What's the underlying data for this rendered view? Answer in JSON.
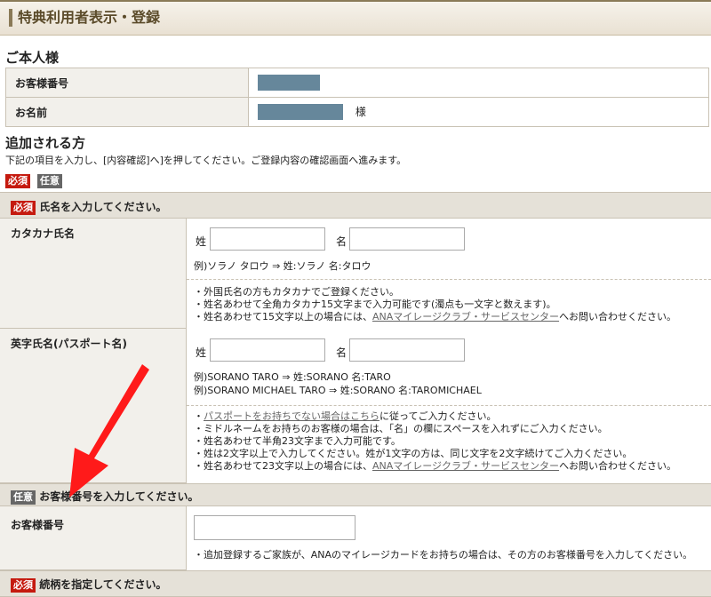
{
  "page_title": "特典利用者表示・登録",
  "self_section": {
    "heading": "ご本人様",
    "rows": [
      {
        "label": "お客様番号",
        "suffix": ""
      },
      {
        "label": "お名前",
        "suffix": "様"
      }
    ]
  },
  "add_section": {
    "heading": "追加される方",
    "instruction": "下記の項目を入力し、[内容確認]へ]を押してください。ご登録内容の確認画面へ進みます。",
    "legend_required": "必須",
    "legend_optional": "任意"
  },
  "name_block": {
    "badge": "必須",
    "title": "氏名を入力してください。",
    "katakana": {
      "label": "カタカナ氏名",
      "last_label": "姓",
      "first_label": "名",
      "example": "例)ソラノ タロウ ⇒ 姓:ソラノ 名:タロウ",
      "notes": [
        "・外国氏名の方もカタカナでご登録ください。",
        "・姓名あわせて全角カタカナ15文字まで入力可能です(濁点も一文字と数えます)。",
        "・姓名あわせて15文字以上の場合には、"
      ],
      "note_link": "ANAマイレージクラブ・サービスセンター",
      "note_tail": "へお問い合わせください。"
    },
    "romaji": {
      "label": "英字氏名(パスポート名)",
      "last_label": "姓",
      "first_label": "名",
      "example1": "例)SORANO TARO ⇒ 姓:SORANO 名:TARO",
      "example2": "例)SORANO MICHAEL TARO ⇒ 姓:SORANO 名:TAROMICHAEL",
      "note1_link": "パスポートをお持ちでない場合はこちら",
      "note1_tail": "に従ってご入力ください。",
      "notes": [
        "・ミドルネームをお持ちのお客様の場合は、「名」の欄にスペースを入れずにご入力ください。",
        "・姓名あわせて半角23文字まで入力可能です。",
        "・姓は2文字以上で入力してください。姓が1文字の方は、同じ文字を2文字続けてご入力ください。",
        "・姓名あわせて23文字以上の場合には、"
      ],
      "note_link": "ANAマイレージクラブ・サービスセンター",
      "note_tail": "へお問い合わせください。"
    }
  },
  "member_block": {
    "badge": "任意",
    "title": "お客様番号を入力してください。",
    "label": "お客様番号",
    "note": "・追加登録するご家族が、ANAのマイレージカードをお持ちの場合は、その方のお客様番号を入力してください。"
  },
  "relation_block": {
    "badge": "必須",
    "title": "続柄を指定してください。"
  },
  "colors": {
    "required": "#c51a0f",
    "optional": "#666666",
    "mask": "#66879b",
    "arrow": "#ff1a1a"
  }
}
